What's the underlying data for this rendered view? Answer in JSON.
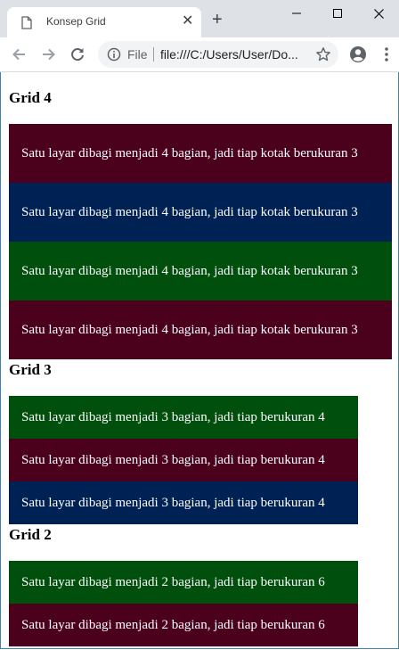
{
  "browser": {
    "tab_title": "Konsep Grid",
    "tab_close": "✕",
    "new_tab": "+",
    "scheme": "File",
    "url": "file:///C:/Users/User/Do..."
  },
  "page": {
    "grid4": {
      "heading": "Grid 4",
      "boxes": [
        "Satu layar dibagi menjadi 4 bagian, jadi tiap kotak berukuran 3",
        "Satu layar dibagi menjadi 4 bagian, jadi tiap kotak berukuran 3",
        "Satu layar dibagi menjadi 4 bagian, jadi tiap kotak berukuran 3",
        "Satu layar dibagi menjadi 4 bagian, jadi tiap kotak berukuran 3"
      ]
    },
    "grid3": {
      "heading": "Grid 3",
      "boxes": [
        "Satu layar dibagi menjadi 3 bagian, jadi tiap berukuran 4",
        "Satu layar dibagi menjadi 3 bagian, jadi tiap berukuran 4",
        "Satu layar dibagi menjadi 3 bagian, jadi tiap berukuran 4"
      ]
    },
    "grid2": {
      "heading": "Grid 2",
      "boxes": [
        "Satu layar dibagi menjadi 2 bagian, jadi tiap berukuran 6",
        "Satu layar dibagi menjadi 2 bagian, jadi tiap berukuran 6"
      ]
    }
  },
  "colors": {
    "maroon": "#4b001c",
    "navy": "#002154",
    "green": "#004f0c"
  }
}
